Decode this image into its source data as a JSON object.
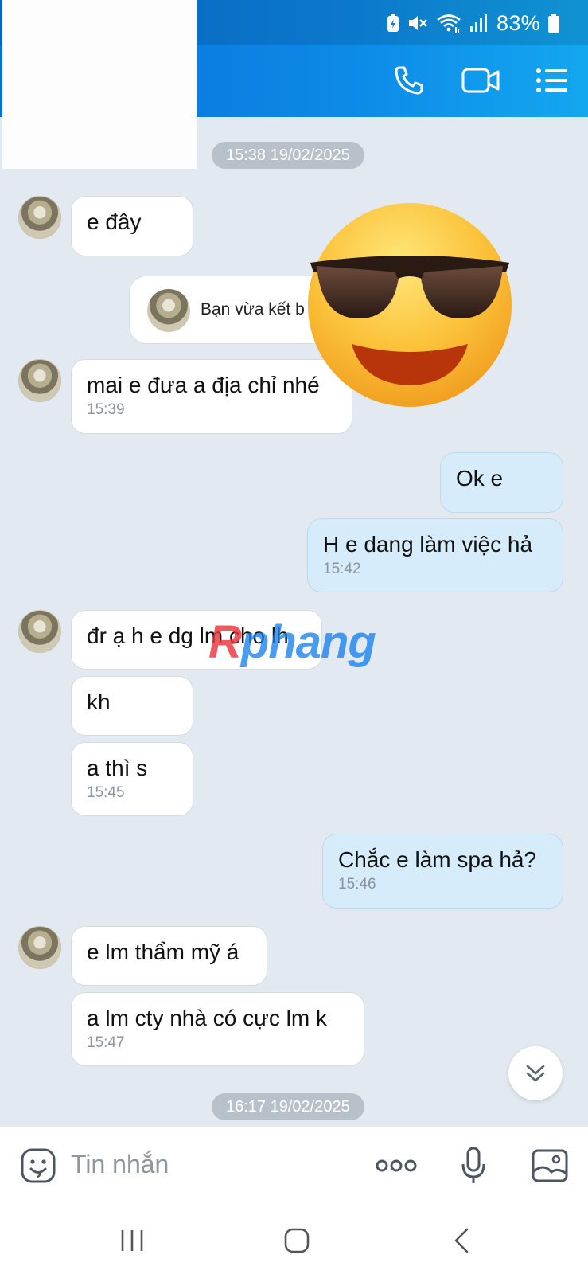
{
  "status_bar": {
    "battery_percent": "83%",
    "icons": [
      "battery-saver-icon",
      "mute-icon",
      "wifi-icon",
      "signal-icon",
      "battery-icon"
    ]
  },
  "header": {
    "actions": [
      "phone-call-icon",
      "video-call-icon",
      "menu-list-icon"
    ]
  },
  "messages": {
    "date_1": "15:38 19/02/2025",
    "m1": {
      "text": "e đây"
    },
    "contact_card": {
      "text": "Bạn vừa kết b"
    },
    "m2": {
      "text": "mai e đưa a địa chỉ nhé",
      "time": "15:39"
    },
    "m3": {
      "text": "Ok e"
    },
    "m4": {
      "text": "H e dang làm việc hả",
      "time": "15:42"
    },
    "m5": {
      "text": "đr ạ h e dg lm cho lh"
    },
    "m6": {
      "text": "kh"
    },
    "m7": {
      "text": "a thì s",
      "time": "15:45"
    },
    "m8": {
      "text": "Chắc e làm spa hả?",
      "time": "15:46"
    },
    "m9": {
      "text": "e lm thẩm mỹ á"
    },
    "m10": {
      "text": "a lm cty nhà có cực lm k",
      "time": "15:47"
    },
    "date_2": "16:17 19/02/2025"
  },
  "watermark": {
    "r": "R",
    "rest": "phang"
  },
  "composer": {
    "placeholder": "Tin nhắn",
    "icons": [
      "sticker-icon",
      "more-icon",
      "microphone-icon",
      "image-icon"
    ]
  },
  "colors": {
    "header": "#0d8ae8",
    "background": "#e2e9f1",
    "outgoing_bubble": "#d6ecfb",
    "incoming_bubble": "#ffffff"
  }
}
